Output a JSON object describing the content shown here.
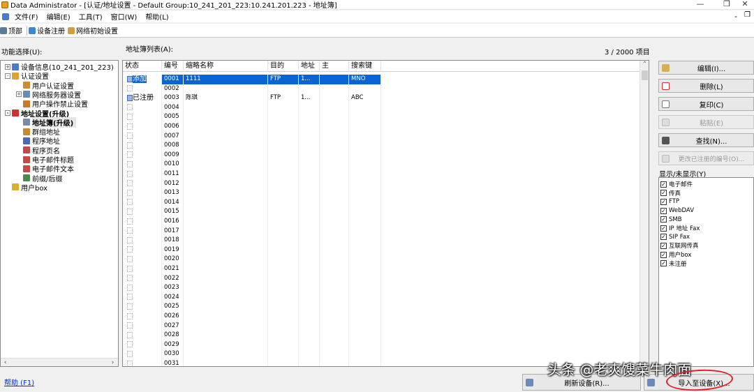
{
  "window": {
    "title": "Data Administrator - [认证/地址设置 - Default Group:10_241_201_223:10.241.201.223 - 地址簿]",
    "minimize_glyph": "—",
    "restore_glyph": "❐",
    "close_glyph": "✕",
    "child_min_glyph": "-",
    "child_restore_glyph": "❐"
  },
  "menu": {
    "items": [
      "文件(F)",
      "编辑(E)",
      "工具(T)",
      "窗口(W)",
      "帮助(L)"
    ]
  },
  "toolbar": {
    "top_label": "顶部",
    "register_label": "设备注册",
    "network_label": "网络初始设置"
  },
  "left_panel": {
    "label": "功能选择(U):",
    "tree": [
      {
        "label": "设备信息(10_241_201_223)",
        "indent": 0,
        "toggle": "+",
        "icon_color": "#4a7ac8"
      },
      {
        "label": "认证设置",
        "indent": 0,
        "toggle": "-",
        "icon_color": "#d9a23a"
      },
      {
        "label": "用户认证设置",
        "indent": 1,
        "toggle": "",
        "icon_color": "#d08a30"
      },
      {
        "label": "网络服务器设置",
        "indent": 1,
        "toggle": "+",
        "icon_color": "#6a8ab8"
      },
      {
        "label": "用户操作禁止设置",
        "indent": 1,
        "toggle": "",
        "icon_color": "#c87a28"
      },
      {
        "label": "地址设置(升级)",
        "indent": 0,
        "toggle": "-",
        "icon_color": "#d03030",
        "bold": true
      },
      {
        "label": "地址簿(升级)",
        "indent": 1,
        "toggle": "",
        "icon_color": "#7a8aa8",
        "bold": true,
        "selected": true
      },
      {
        "label": "群组地址",
        "indent": 1,
        "toggle": "",
        "icon_color": "#c88a30"
      },
      {
        "label": "程序地址",
        "indent": 1,
        "toggle": "",
        "icon_color": "#4a6ab8"
      },
      {
        "label": "程序页名",
        "indent": 1,
        "toggle": "",
        "icon_color": "#c84848"
      },
      {
        "label": "电子邮件标题",
        "indent": 1,
        "toggle": "",
        "icon_color": "#c84848"
      },
      {
        "label": "电子邮件文本",
        "indent": 1,
        "toggle": "",
        "icon_color": "#c84848"
      },
      {
        "label": "前缀/后缀",
        "indent": 1,
        "toggle": "",
        "icon_color": "#4a8a4a"
      },
      {
        "label": "用户box",
        "indent": 0,
        "toggle": "",
        "icon_color": "#d8b030"
      }
    ]
  },
  "address_list": {
    "label": "地址簿列表(A):",
    "count": "3 / 2000 项目",
    "columns": [
      "状态",
      "编号",
      "缩略名称",
      "目的",
      "地址",
      "主",
      "搜索键"
    ],
    "rows": [
      {
        "status": "添加",
        "no": "0001",
        "name": "1111",
        "dest": "FTP",
        "addr": "1...",
        "main": "",
        "key": "MNO",
        "selected": true,
        "icon": true
      },
      {
        "status": "",
        "no": "0002",
        "name": "",
        "dest": "",
        "addr": "",
        "main": "",
        "key": ""
      },
      {
        "status": "已注册",
        "no": "0003",
        "name": "陈琪",
        "dest": "FTP",
        "addr": "1...",
        "main": "",
        "key": "ABC",
        "icon": true
      },
      {
        "status": "",
        "no": "0004"
      },
      {
        "status": "",
        "no": "0005"
      },
      {
        "status": "",
        "no": "0006"
      },
      {
        "status": "",
        "no": "0007"
      },
      {
        "status": "",
        "no": "0008"
      },
      {
        "status": "",
        "no": "0009"
      },
      {
        "status": "",
        "no": "0010"
      },
      {
        "status": "",
        "no": "0011"
      },
      {
        "status": "",
        "no": "0012"
      },
      {
        "status": "",
        "no": "0013"
      },
      {
        "status": "",
        "no": "0014"
      },
      {
        "status": "",
        "no": "0015"
      },
      {
        "status": "",
        "no": "0016"
      },
      {
        "status": "",
        "no": "0017"
      },
      {
        "status": "",
        "no": "0018"
      },
      {
        "status": "",
        "no": "0019"
      },
      {
        "status": "",
        "no": "0020"
      },
      {
        "status": "",
        "no": "0021"
      },
      {
        "status": "",
        "no": "0022"
      },
      {
        "status": "",
        "no": "0023"
      },
      {
        "status": "",
        "no": "0024"
      },
      {
        "status": "",
        "no": "0025"
      },
      {
        "status": "",
        "no": "0026"
      },
      {
        "status": "",
        "no": "0027"
      },
      {
        "status": "",
        "no": "0028"
      },
      {
        "status": "",
        "no": "0029"
      },
      {
        "status": "",
        "no": "0030"
      },
      {
        "status": "",
        "no": "0031"
      }
    ]
  },
  "right_panel": {
    "edit_label": "编辑(I)...",
    "delete_label": "删除(L)",
    "copy_label": "复印(C)",
    "paste_label": "粘贴(E)",
    "find_label": "查找(N)...",
    "change_label": "更改已注册的编号(O)...",
    "filter_label": "显示/未显示(Y)",
    "filters": [
      "电子邮件",
      "传真",
      "FTP",
      "WebDAV",
      "SMB",
      "IP 地址 Fax",
      "SIP Fax",
      "互联网传真",
      "用户box",
      "未注册"
    ]
  },
  "bottom": {
    "help_link": "帮助 (F1)",
    "refresh_label": "刷新设备(R)...",
    "import_label": "导入至设备(X)..."
  },
  "watermark": "头条 @老爽馊菜牛肉面",
  "colors": {
    "selection": "#0a64d4",
    "annotation_red": "#e0202a"
  }
}
